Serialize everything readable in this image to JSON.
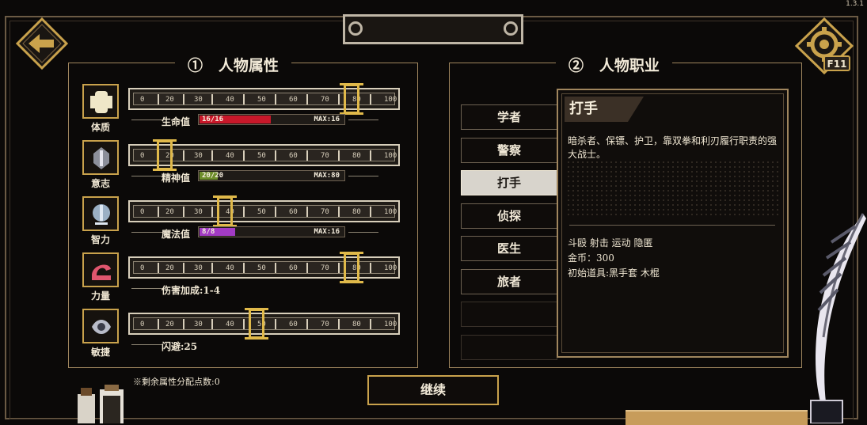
{
  "version": "1.3.1",
  "hotkey": "F11",
  "attributes_panel": {
    "number": "①",
    "title": "人物属性",
    "tick_labels": [
      "0",
      "20",
      "30",
      "40",
      "50",
      "60",
      "70",
      "80",
      "100"
    ],
    "rows": [
      {
        "name": "体质",
        "value": 80,
        "stat_label": "生命值",
        "bar_text": "16/16",
        "bar_max": "MAX:16",
        "bar_fill": 1.0,
        "bar_color": "#c8182a"
      },
      {
        "name": "意志",
        "value": 20,
        "stat_label": "精神值",
        "bar_text": "20/20",
        "bar_max": "MAX:80",
        "bar_fill": 0.25,
        "bar_color": "#6d8d2a"
      },
      {
        "name": "智力",
        "value": 40,
        "stat_label": "魔法值",
        "bar_text": "8/8",
        "bar_max": "MAX:16",
        "bar_fill": 0.5,
        "bar_color": "#a23bc4"
      },
      {
        "name": "力量",
        "value": 80,
        "stat_label": "伤害加成:1-4"
      },
      {
        "name": "敏捷",
        "value": 50,
        "stat_label": "闪避:25"
      }
    ],
    "remaining_points": "※剩余属性分配点数:0"
  },
  "jobs_panel": {
    "number": "②",
    "title": "人物职业",
    "jobs": [
      "学者",
      "警察",
      "打手",
      "侦探",
      "医生",
      "旅者"
    ],
    "selected_index": 2
  },
  "job_detail": {
    "title": "打手",
    "description": "暗杀者、保镖、护卫，靠双拳和利刃履行职责的强大战士。",
    "skills": "斗殴 射击 运动 隐匿",
    "gold": "金币：300",
    "items": "初始道具:黑手套 木棍"
  },
  "continue_label": "继续"
}
